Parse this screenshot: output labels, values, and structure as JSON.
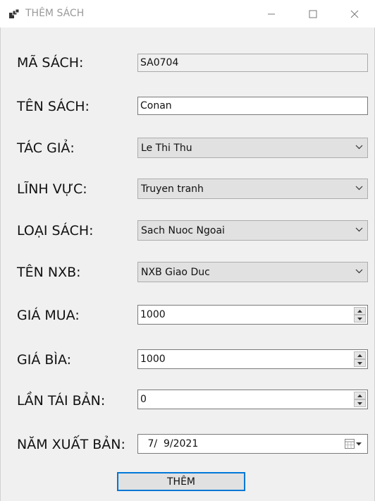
{
  "window": {
    "title": "THÊM SÁCH",
    "controls": {
      "minimize": "minimize-icon",
      "maximize": "maximize-icon",
      "close": "close-icon"
    }
  },
  "form": {
    "ma_sach": {
      "label": "MÃ SÁCH:",
      "value": "SA0704"
    },
    "ten_sach": {
      "label": "TÊN SÁCH:",
      "value": "Conan"
    },
    "tac_gia": {
      "label": "TÁC GIẢ:",
      "value": "Le Thi Thu"
    },
    "linh_vuc": {
      "label": "LĨNH VỰC:",
      "value": "Truyen tranh"
    },
    "loai_sach": {
      "label": "LOẠI SÁCH:",
      "value": "Sach Nuoc Ngoai"
    },
    "ten_nxb": {
      "label": "TÊN NXB:",
      "value": "NXB Giao Duc"
    },
    "gia_mua": {
      "label": "GIÁ MUA:",
      "value": "1000"
    },
    "gia_bia": {
      "label": "GIÁ BÌA:",
      "value": "1000"
    },
    "lan_tai_ban": {
      "label": "LẦN TÁI BẢN:",
      "value": "0"
    },
    "nam_xuat_ban": {
      "label": "NĂM XUẤT BẢN:",
      "value": " 7/  9/2021"
    }
  },
  "actions": {
    "add_label": "THÊM"
  },
  "colors": {
    "accent": "#0078d7",
    "window_bg": "#f0f0f0",
    "combo_bg": "#e1e1e1"
  }
}
